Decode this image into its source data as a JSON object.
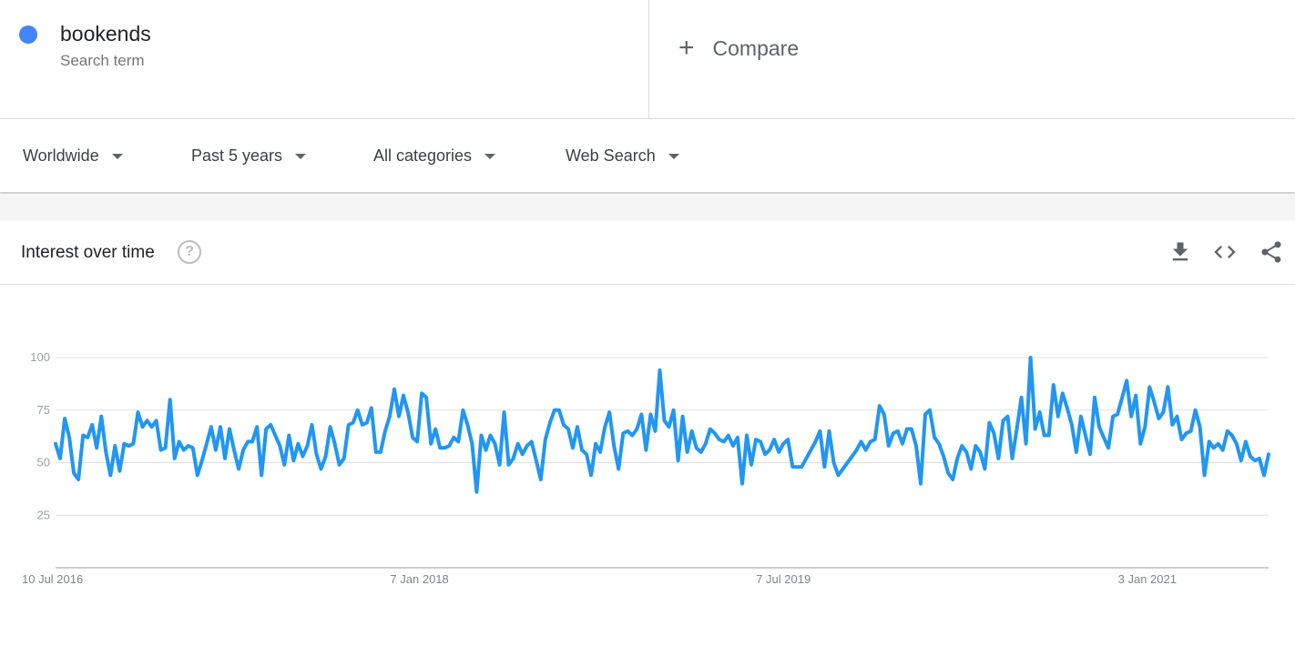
{
  "search_term": {
    "name": "bookends",
    "subtitle": "Search term",
    "color": "#4285f4"
  },
  "compare": {
    "icon": "plus-icon",
    "label": "Compare"
  },
  "filters": [
    {
      "label": "Worldwide"
    },
    {
      "label": "Past 5 years"
    },
    {
      "label": "All categories"
    },
    {
      "label": "Web Search"
    }
  ],
  "card": {
    "title": "Interest over time",
    "help_icon": "?",
    "actions": [
      "download-icon",
      "embed-code-icon",
      "share-icon"
    ]
  },
  "chart_data": {
    "type": "line",
    "title": "Interest over time",
    "series": [
      {
        "name": "bookends",
        "color": "#2196f3",
        "values": [
          59,
          52,
          71,
          62,
          45,
          42,
          63,
          62,
          68,
          57,
          72,
          55,
          44,
          58,
          46,
          59,
          58,
          59,
          74,
          67,
          70,
          67,
          70,
          56,
          57,
          80,
          52,
          60,
          56,
          58,
          57,
          44,
          51,
          59,
          67,
          56,
          67,
          52,
          66,
          56,
          47,
          56,
          60,
          60,
          67,
          44,
          66,
          68,
          63,
          58,
          49,
          63,
          51,
          59,
          53,
          58,
          68,
          54,
          47,
          53,
          67,
          59,
          49,
          52,
          68,
          69,
          75,
          68,
          69,
          76,
          55,
          55,
          65,
          72,
          85,
          72,
          82,
          74,
          62,
          60,
          83,
          81,
          59,
          66,
          57,
          57,
          58,
          62,
          60,
          75,
          68,
          59,
          36,
          63,
          56,
          63,
          59,
          49,
          74,
          49,
          52,
          59,
          54,
          58,
          60,
          51,
          42,
          61,
          69,
          75,
          75,
          68,
          66,
          57,
          67,
          56,
          54,
          44,
          59,
          55,
          67,
          74,
          58,
          47,
          64,
          65,
          63,
          66,
          73,
          56,
          73,
          65,
          94,
          70,
          67,
          75,
          51,
          72,
          55,
          65,
          57,
          55,
          59,
          66,
          64,
          61,
          60,
          63,
          58,
          62,
          40,
          63,
          49,
          61,
          60,
          54,
          56,
          61,
          55,
          59,
          61,
          48,
          48,
          48,
          52,
          56,
          60,
          65,
          48,
          65,
          50,
          44,
          47,
          50,
          53,
          56,
          60,
          56,
          60,
          61,
          77,
          73,
          58,
          64,
          65,
          59,
          66,
          66,
          58,
          40,
          73,
          75,
          62,
          59,
          53,
          45,
          42,
          52,
          58,
          55,
          47,
          58,
          55,
          47,
          69,
          64,
          52,
          70,
          72,
          52,
          66,
          81,
          59,
          100,
          66,
          74,
          63,
          63,
          87,
          72,
          83,
          76,
          68,
          55,
          72,
          63,
          54,
          81,
          67,
          62,
          57,
          72,
          73,
          81,
          89,
          72,
          82,
          59,
          67,
          86,
          79,
          71,
          74,
          86,
          68,
          72,
          61,
          64,
          65,
          75,
          67,
          44,
          60,
          57,
          59,
          56,
          65,
          63,
          59,
          51,
          60,
          53,
          51,
          52,
          44,
          54
        ]
      }
    ],
    "x_start": "2016-07-10",
    "x_end": "2021-07-04",
    "x_ticks": [
      {
        "label": "10 Jul 2016",
        "date": "2016-07-10"
      },
      {
        "label": "7 Jan 2018",
        "date": "2018-01-07"
      },
      {
        "label": "7 Jul 2019",
        "date": "2019-07-07"
      },
      {
        "label": "3 Jan 2021",
        "date": "2021-01-03"
      }
    ],
    "y_ticks": [
      {
        "label": "100",
        "value": 100
      },
      {
        "label": "75",
        "value": 75
      },
      {
        "label": "50",
        "value": 50
      },
      {
        "label": "25",
        "value": 25
      }
    ],
    "ylim": [
      0,
      100
    ],
    "grid": true,
    "legend": "none"
  }
}
